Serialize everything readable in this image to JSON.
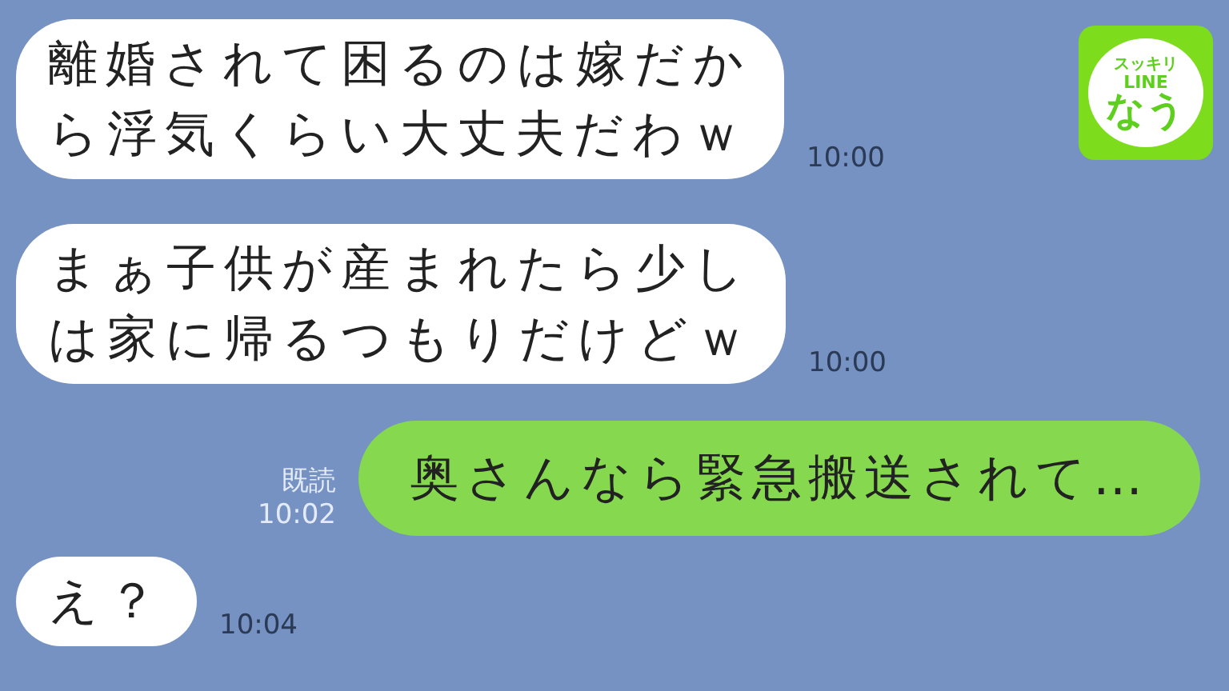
{
  "logo": {
    "lines": [
      "スッキリ",
      "LINE",
      "なう"
    ]
  },
  "messages": [
    {
      "kind": "received",
      "lines": [
        "離婚されて困るのは嫁だか",
        "ら浮気くらい大丈夫だわｗ"
      ],
      "time": "10:00"
    },
    {
      "kind": "received",
      "lines": [
        "まぁ子供が産まれたら少し",
        "は家に帰るつもりだけどｗ"
      ],
      "time": "10:00"
    },
    {
      "kind": "sent",
      "lines": [
        "奥さんなら緊急搬送されて…"
      ],
      "read": "既読",
      "time": "10:02"
    },
    {
      "kind": "received",
      "lines": [
        "え？"
      ],
      "time": "10:04"
    }
  ]
}
